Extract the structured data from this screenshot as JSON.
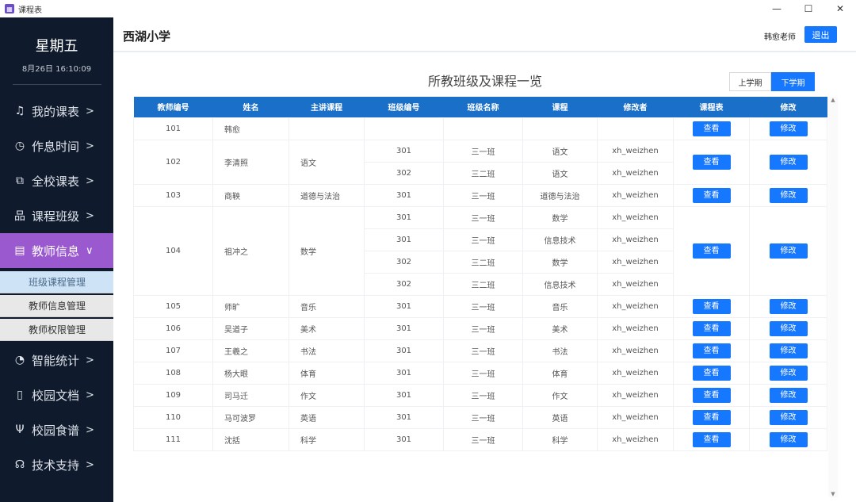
{
  "window": {
    "title": "课程表",
    "minimize": "—",
    "maximize": "☐",
    "close": "✕"
  },
  "sidebar": {
    "day": "星期五",
    "datetime": "8月26日  16:10:09",
    "items": [
      {
        "icon": "bell",
        "label": "我的课表",
        "arrow": ">"
      },
      {
        "icon": "clock",
        "label": "作息时间",
        "arrow": ">"
      },
      {
        "icon": "copy",
        "label": "全校课表",
        "arrow": ">"
      },
      {
        "icon": "org",
        "label": "课程班级",
        "arrow": ">"
      },
      {
        "icon": "form",
        "label": "教师信息",
        "arrow": "∨"
      },
      {
        "icon": "pie",
        "label": "智能统计",
        "arrow": ">"
      },
      {
        "icon": "doc",
        "label": "校园文档",
        "arrow": ">"
      },
      {
        "icon": "fork",
        "label": "校园食谱",
        "arrow": ">"
      },
      {
        "icon": "support",
        "label": "技术支持",
        "arrow": ">"
      }
    ],
    "subitems": [
      {
        "label": "班级课程管理"
      },
      {
        "label": "教师信息管理"
      },
      {
        "label": "教师权限管理"
      }
    ]
  },
  "header": {
    "school": "西湖小学",
    "teacher": "韩愈老师",
    "logout": "退出"
  },
  "main": {
    "title": "所教班级及课程一览",
    "semesters": [
      "上学期",
      "下学期"
    ],
    "columns": [
      "教师编号",
      "姓名",
      "主讲课程",
      "班级编号",
      "班级名称",
      "课程",
      "修改者",
      "课程表",
      "修改"
    ],
    "view_label": "查看",
    "edit_label": "修改",
    "teachers": [
      {
        "id": "101",
        "name": "韩愈",
        "subject": "",
        "rows": [
          {
            "class_id": "",
            "class_name": "",
            "course": "",
            "editor": ""
          }
        ]
      },
      {
        "id": "102",
        "name": "李清照",
        "subject": "语文",
        "rows": [
          {
            "class_id": "301",
            "class_name": "三一班",
            "course": "语文",
            "editor": "xh_weizhen"
          },
          {
            "class_id": "302",
            "class_name": "三二班",
            "course": "语文",
            "editor": "xh_weizhen"
          }
        ]
      },
      {
        "id": "103",
        "name": "商鞅",
        "subject": "道德与法治",
        "rows": [
          {
            "class_id": "301",
            "class_name": "三一班",
            "course": "道德与法治",
            "editor": "xh_weizhen"
          }
        ]
      },
      {
        "id": "104",
        "name": "祖冲之",
        "subject": "数学",
        "rows": [
          {
            "class_id": "301",
            "class_name": "三一班",
            "course": "数学",
            "editor": "xh_weizhen"
          },
          {
            "class_id": "301",
            "class_name": "三一班",
            "course": "信息技术",
            "editor": "xh_weizhen"
          },
          {
            "class_id": "302",
            "class_name": "三二班",
            "course": "数学",
            "editor": "xh_weizhen"
          },
          {
            "class_id": "302",
            "class_name": "三二班",
            "course": "信息技术",
            "editor": "xh_weizhen"
          }
        ]
      },
      {
        "id": "105",
        "name": "师旷",
        "subject": "音乐",
        "rows": [
          {
            "class_id": "301",
            "class_name": "三一班",
            "course": "音乐",
            "editor": "xh_weizhen"
          }
        ]
      },
      {
        "id": "106",
        "name": "吴道子",
        "subject": "美术",
        "rows": [
          {
            "class_id": "301",
            "class_name": "三一班",
            "course": "美术",
            "editor": "xh_weizhen"
          }
        ]
      },
      {
        "id": "107",
        "name": "王羲之",
        "subject": "书法",
        "rows": [
          {
            "class_id": "301",
            "class_name": "三一班",
            "course": "书法",
            "editor": "xh_weizhen"
          }
        ]
      },
      {
        "id": "108",
        "name": "杨大眼",
        "subject": "体育",
        "rows": [
          {
            "class_id": "301",
            "class_name": "三一班",
            "course": "体育",
            "editor": "xh_weizhen"
          }
        ]
      },
      {
        "id": "109",
        "name": "司马迁",
        "subject": "作文",
        "rows": [
          {
            "class_id": "301",
            "class_name": "三一班",
            "course": "作文",
            "editor": "xh_weizhen"
          }
        ]
      },
      {
        "id": "110",
        "name": "马可波罗",
        "subject": "英语",
        "rows": [
          {
            "class_id": "301",
            "class_name": "三一班",
            "course": "英语",
            "editor": "xh_weizhen"
          }
        ]
      },
      {
        "id": "111",
        "name": "沈括",
        "subject": "科学",
        "rows": [
          {
            "class_id": "301",
            "class_name": "三一班",
            "course": "科学",
            "editor": "xh_weizhen"
          }
        ]
      }
    ]
  }
}
